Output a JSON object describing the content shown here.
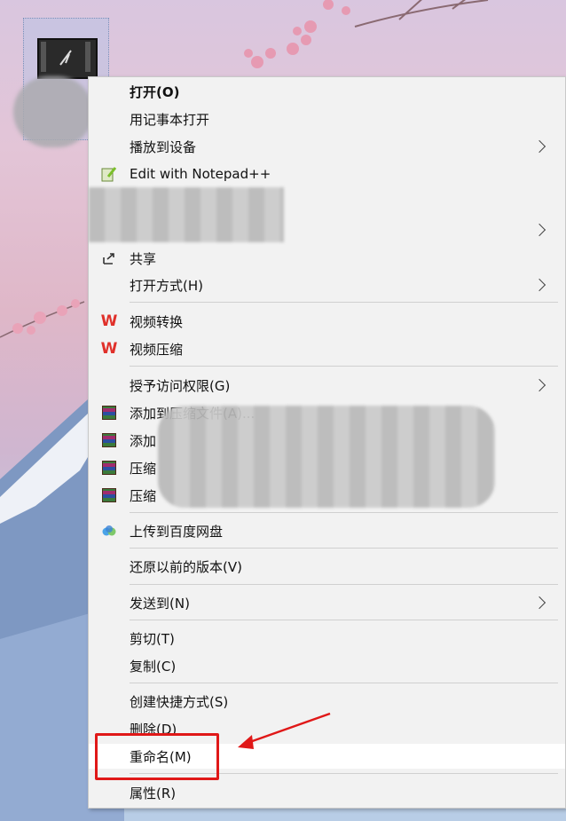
{
  "desktop": {
    "icon": {
      "icon_name": "video-file-icon"
    }
  },
  "context_menu": {
    "items": [
      {
        "label": "打开(O)",
        "bold": true
      },
      {
        "label": "用记事本打开"
      },
      {
        "label": "播放到设备",
        "submenu": true
      },
      {
        "label": "Edit with Notepad++",
        "icon": "notepad-plus-icon"
      },
      {
        "label": "共享",
        "icon": "share-icon"
      },
      {
        "label": "打开方式(H)",
        "submenu": true
      },
      {
        "label": "视频转换",
        "icon": "wps-icon"
      },
      {
        "label": "视频压缩",
        "icon": "wps-icon"
      },
      {
        "label": "授予访问权限(G)",
        "submenu": true
      },
      {
        "label": "添加到压缩文件(A)...",
        "icon": "winrar-icon"
      },
      {
        "label": "添加",
        "icon": "winrar-icon"
      },
      {
        "label": "压缩",
        "icon": "winrar-icon"
      },
      {
        "label": "压缩",
        "icon": "winrar-icon"
      },
      {
        "label": "上传到百度网盘",
        "icon": "baidu-cloud-icon"
      },
      {
        "label": "还原以前的版本(V)"
      },
      {
        "label": "发送到(N)",
        "submenu": true
      },
      {
        "label": "剪切(T)"
      },
      {
        "label": "复制(C)"
      },
      {
        "label": "创建快捷方式(S)"
      },
      {
        "label": "删除(D)"
      },
      {
        "label": "重命名(M)",
        "highlighted": true
      },
      {
        "label": "属性(R)"
      }
    ]
  },
  "annotation": {
    "color": "#e01818",
    "target": "重命名(M)"
  }
}
